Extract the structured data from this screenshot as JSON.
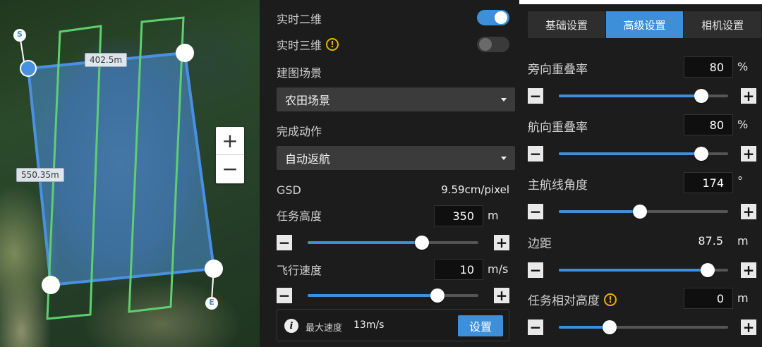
{
  "map": {
    "start_marker": "S",
    "end_marker": "E",
    "dist_width": "402.5m",
    "dist_height": "550.35m",
    "zoom_in": "+",
    "zoom_out": "−"
  },
  "panel": {
    "realtime_2d": {
      "label": "实时二维",
      "on": true
    },
    "realtime_3d": {
      "label": "实时三维",
      "on": false
    },
    "scene": {
      "label": "建图场景",
      "value": "农田场景"
    },
    "finish_action": {
      "label": "完成动作",
      "value": "自动返航"
    },
    "gsd": {
      "label": "GSD",
      "value": "9.59cm/pixel"
    },
    "altitude": {
      "label": "任务高度",
      "value": "350",
      "unit": "m",
      "level": 0.67
    },
    "speed": {
      "label": "飞行速度",
      "value": "10",
      "unit": "m/s",
      "level": 0.76
    },
    "info": {
      "icon": "i",
      "max_speed_label": "最大速度",
      "max_speed_value": "13m/s",
      "button": "设置"
    }
  },
  "advanced": {
    "tabs": [
      {
        "label": "基础设置",
        "active": false
      },
      {
        "label": "高级设置",
        "active": true
      },
      {
        "label": "相机设置",
        "active": false
      }
    ],
    "side_overlap": {
      "label": "旁向重叠率",
      "value": "80",
      "unit": "%",
      "level": 0.84
    },
    "front_overlap": {
      "label": "航向重叠率",
      "value": "80",
      "unit": "%",
      "level": 0.84
    },
    "main_angle": {
      "label": "主航线角度",
      "value": "174",
      "unit": "°",
      "level": 0.48
    },
    "margin": {
      "label": "边距",
      "value": "87.5",
      "unit": "m",
      "level": 0.88
    },
    "relative_height": {
      "label": "任务相对高度",
      "value": "0",
      "unit": "m",
      "level": 0.3
    }
  },
  "colors": {
    "accent": "#3d8fd9",
    "route": "#58c46a",
    "area": "#4a90d9",
    "warn": "#e6b400"
  }
}
